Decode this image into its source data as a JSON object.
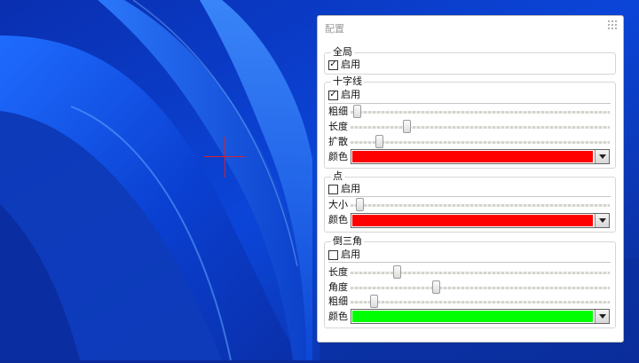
{
  "panel": {
    "title": "配置"
  },
  "global": {
    "title": "全局",
    "enabled": {
      "label": "启用",
      "checked": true
    }
  },
  "crosshair": {
    "title": "十字线",
    "enabled": {
      "label": "启用",
      "checked": true
    },
    "thickness": {
      "label": "粗细",
      "value": 0.01
    },
    "length": {
      "label": "长度",
      "value": 0.21
    },
    "spread": {
      "label": "扩散",
      "value": 0.1
    },
    "color": {
      "label": "颜色",
      "value": "#ff0000"
    }
  },
  "dot": {
    "title": "点",
    "enabled": {
      "label": "启用",
      "checked": false
    },
    "size": {
      "label": "大小",
      "value": 0.02
    },
    "color": {
      "label": "颜色",
      "value": "#ff0000"
    }
  },
  "triangle": {
    "title": "倒三角",
    "enabled": {
      "label": "启用",
      "checked": false
    },
    "length": {
      "label": "长度",
      "value": 0.17
    },
    "angle": {
      "label": "角度",
      "value": 0.33
    },
    "thickness": {
      "label": "粗细",
      "value": 0.08
    },
    "color": {
      "label": "颜色",
      "value": "#00ff00"
    }
  },
  "desktop": {
    "crosshair_color": "#d8202a"
  }
}
